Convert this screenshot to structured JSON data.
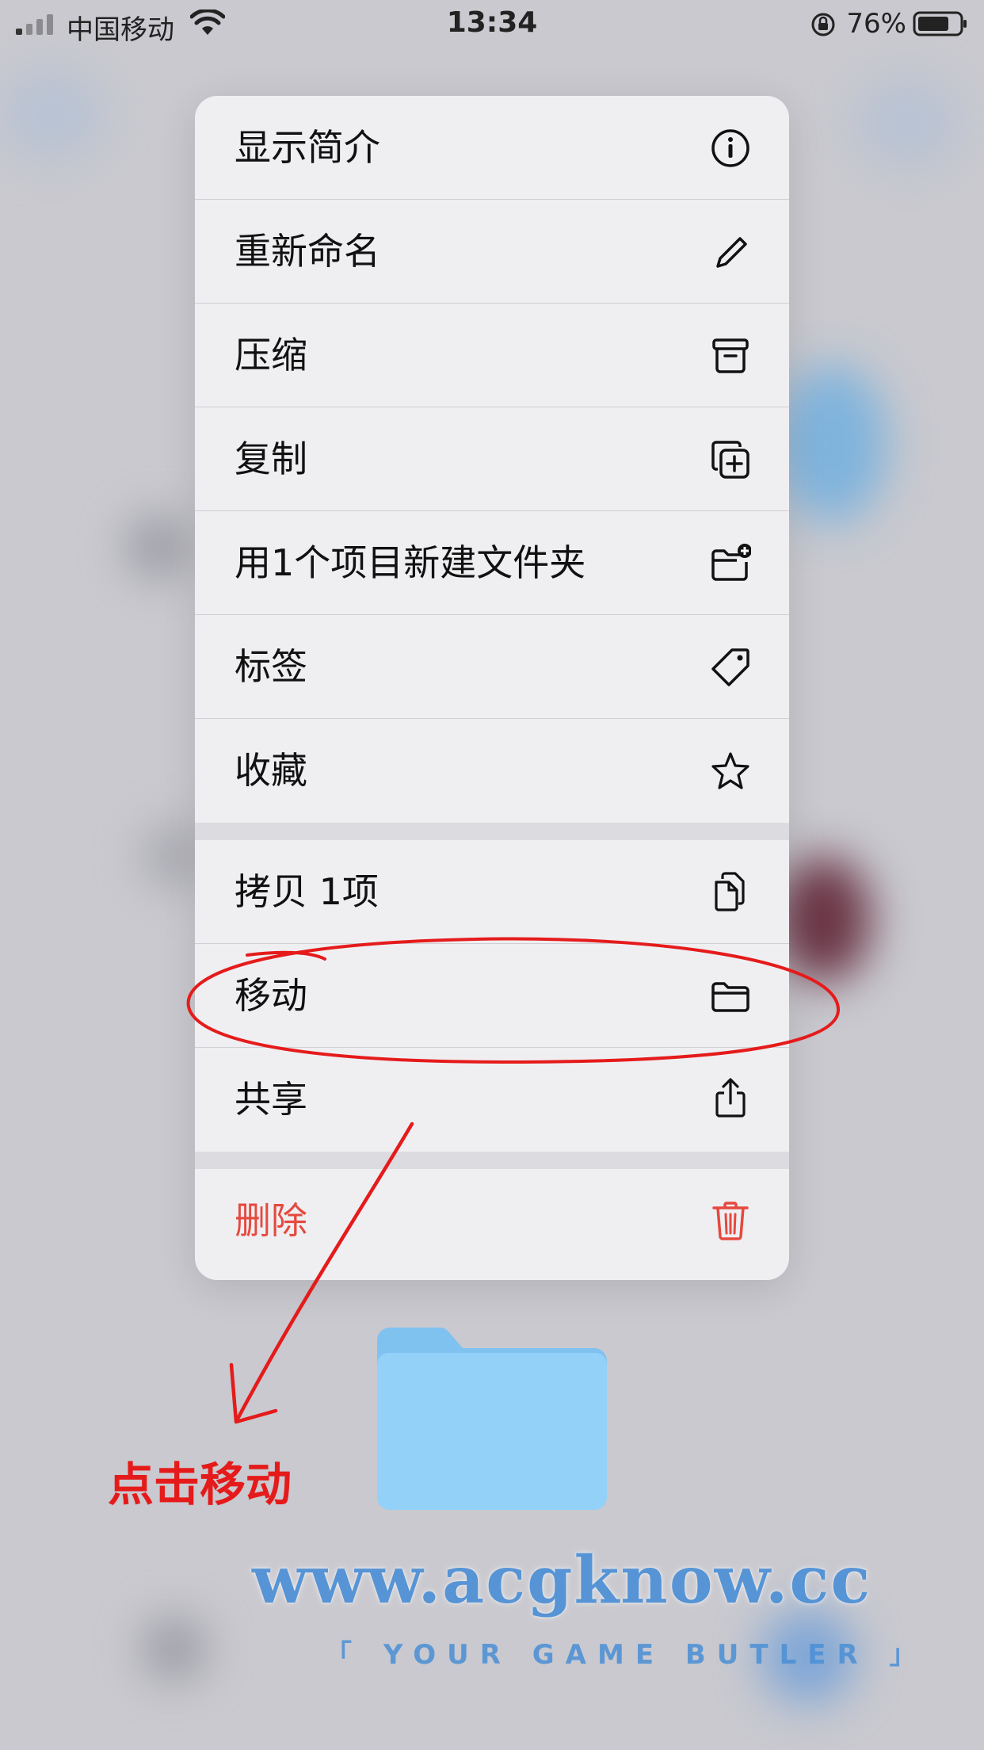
{
  "status_bar": {
    "carrier": "中国移动",
    "time": "13:34",
    "battery_percent": "76%"
  },
  "menu": {
    "groups": [
      [
        {
          "label": "显示简介",
          "icon": "info-icon"
        },
        {
          "label": "重新命名",
          "icon": "pencil-icon"
        },
        {
          "label": "压缩",
          "icon": "archive-box-icon"
        },
        {
          "label": "复制",
          "icon": "duplicate-icon"
        },
        {
          "label": "用1个项目新建文件夹",
          "icon": "folder-add-icon"
        },
        {
          "label": "标签",
          "icon": "tag-icon"
        },
        {
          "label": "收藏",
          "icon": "star-icon"
        }
      ],
      [
        {
          "label": "拷贝 1项",
          "icon": "copy-doc-icon"
        },
        {
          "label": "移动",
          "icon": "folder-icon"
        },
        {
          "label": "共享",
          "icon": "share-icon"
        }
      ],
      [
        {
          "label": "删除",
          "icon": "trash-icon",
          "destructive": true
        }
      ]
    ]
  },
  "annotation": {
    "text": "点击移动",
    "color": "#e51b1b"
  },
  "watermark": {
    "url": "www.acgknow.cc",
    "tagline": "「 YOUR GAME BUTLER 」"
  },
  "colors": {
    "destructive": "#e5493f",
    "folder": "#8fcdf5"
  }
}
